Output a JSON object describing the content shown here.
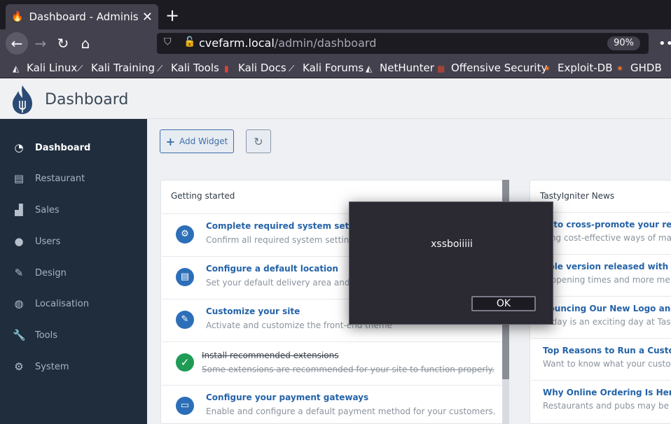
{
  "browser": {
    "tab_title": "Dashboard - Administrat",
    "url_host": "cvefarm.local",
    "url_path": "/admin/dashboard",
    "zoom": "90%",
    "bookmarks": [
      {
        "label": "Kali Linux",
        "icon": "kali-icon"
      },
      {
        "label": "Kali Training",
        "icon": "kali-dragon-icon"
      },
      {
        "label": "Kali Tools",
        "icon": "kali-dragon-icon"
      },
      {
        "label": "Kali Docs",
        "icon": "kali-docs-icon"
      },
      {
        "label": "Kali Forums",
        "icon": "kali-dragon-icon"
      },
      {
        "label": "NetHunter",
        "icon": "nethunter-icon"
      },
      {
        "label": "Offensive Security",
        "icon": "offsec-icon"
      },
      {
        "label": "Exploit-DB",
        "icon": "exploit-db-icon"
      },
      {
        "label": "GHDB",
        "icon": "ghdb-icon"
      }
    ]
  },
  "header": {
    "title": "Dashboard"
  },
  "sidebar": {
    "items": [
      {
        "label": "Dashboard",
        "icon": "tachometer-icon",
        "active": true
      },
      {
        "label": "Restaurant",
        "icon": "store-icon"
      },
      {
        "label": "Sales",
        "icon": "bar-chart-icon"
      },
      {
        "label": "Users",
        "icon": "user-icon"
      },
      {
        "label": "Design",
        "icon": "paintbrush-icon"
      },
      {
        "label": "Localisation",
        "icon": "globe-icon"
      },
      {
        "label": "Tools",
        "icon": "wrench-icon"
      },
      {
        "label": "System",
        "icon": "cogs-icon"
      }
    ]
  },
  "toolbar": {
    "add_widget_label": "Add Widget"
  },
  "getting_started": {
    "title": "Getting started",
    "items": [
      {
        "title": "Complete required system settings",
        "desc": "Confirm all required system settings",
        "icon": "cogs-icon"
      },
      {
        "title": "Configure a default location",
        "desc": "Set your default delivery area and cu",
        "icon": "store-icon"
      },
      {
        "title": "Customize your site",
        "desc": "Activate and customize the front-end theme",
        "icon": "paintbrush-icon"
      },
      {
        "title": "Install recommended extensions",
        "desc": "Some extensions are recommended for your site to function properly.",
        "icon": "check-icon",
        "done": true
      },
      {
        "title": "Configure your payment gateways",
        "desc": "Enable and configure a default payment method for your customers.",
        "icon": "credit-card-icon"
      }
    ]
  },
  "news": {
    "title": "TastyIgniter News",
    "items": [
      {
        "title": "w to cross-promote your res",
        "desc": "ding cost-effective ways of ma"
      },
      {
        "title": "able version released with ta",
        "desc": "it opening times and more me"
      },
      {
        "title": "nouncing Our New Logo and",
        "desc": "Today is an exciting day at Tastyl"
      },
      {
        "title": "Top Reasons to Run a Custome",
        "desc": "Want to know what your custome"
      },
      {
        "title": "Why Online Ordering Is Here to",
        "desc": "Restaurants and pubs may be op"
      }
    ]
  },
  "dialog": {
    "message": "xssboiiiii",
    "ok_label": "OK"
  }
}
